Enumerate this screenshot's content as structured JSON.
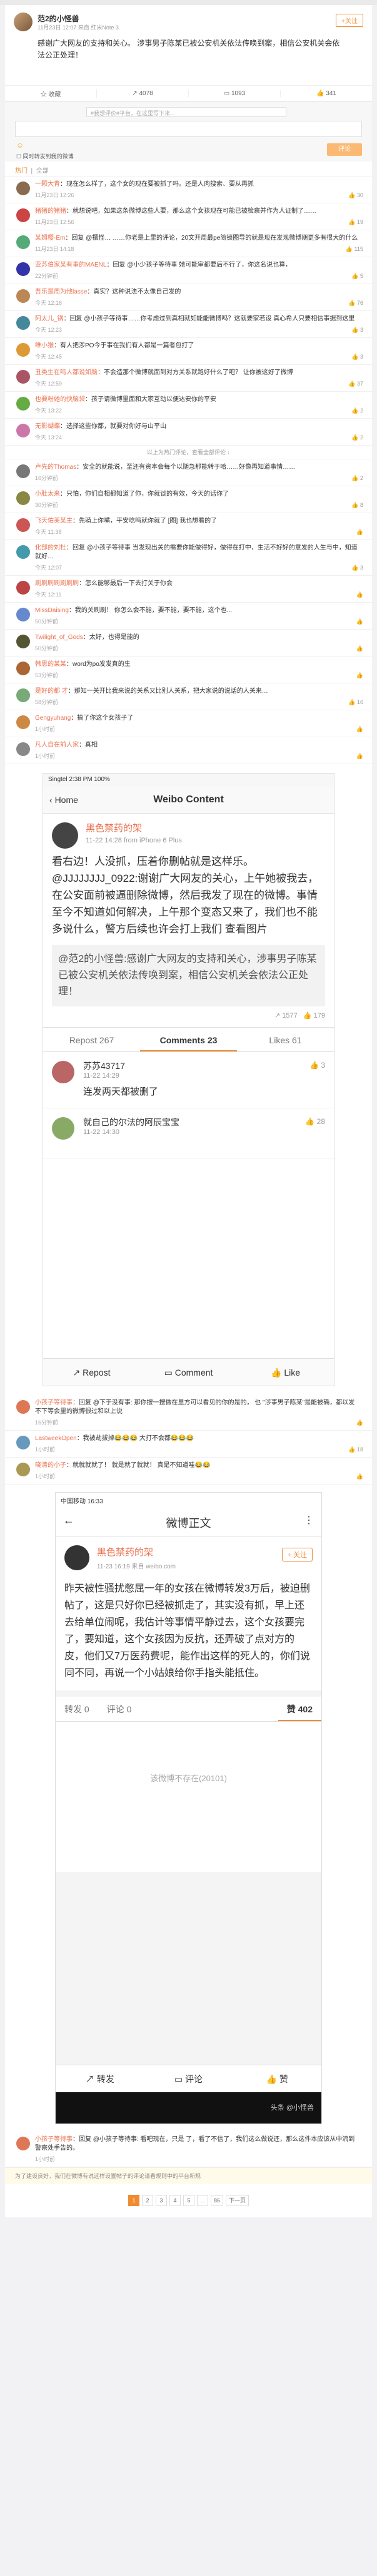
{
  "post": {
    "name": "范2的小怪兽",
    "meta": "11月23日 12:07 来自 红米Note 3",
    "follow": "+关注",
    "text": "感谢广大网友的支持和关心。 涉事男子陈某已被公安机关依法传唤到案，相信公安机关会依法公正处理！",
    "actions": [
      "收藏",
      "4078",
      "1093",
      "341"
    ]
  },
  "comment_box": {
    "placeholder": "#我想评价#平台，在这里写下来...",
    "checkbox_label": "同时转发到我的微博",
    "send": "评论"
  },
  "tabs": {
    "hot": "热门",
    "all": "全部"
  },
  "comments": [
    {
      "user": "一颗大青",
      "text": "现在怎么样了，这个女的现在要被抓了吗。还是人肉搜索、要从再抓",
      "time": "11月23日 12:26",
      "likes": "30",
      "color": "#8a6b4f"
    },
    {
      "user": "猪猪的猪猪",
      "text": "就想说吧，如果这条微博这些人要，那么这个女孩现在可能已被检察并作为人证制了……",
      "time": "11月23日 12:56",
      "likes": "19",
      "color": "#c44"
    },
    {
      "user": "某姆樱-Em",
      "text": "回复 @摆怪… ……你老是上里的评论，20文开周最pe简锁图导的就是现在发现微博期更多有很大的什么",
      "time": "11月23日 14:18",
      "likes": "115",
      "color": "#5a7"
    },
    {
      "user": "亚苏伯家某有事的MAENL",
      "text": "回复 @小少孩子等待事 她可能审都要后不行了，你这名说也算，",
      "time": "22分钟前",
      "likes": "5",
      "color": "#33a"
    },
    {
      "user": "吾乐是周为他lasse",
      "text": "真实？这种说法不太像自己发的",
      "time": "今天 12:16",
      "likes": "76",
      "color": "#b85"
    },
    {
      "user": "阿太儿_锅",
      "text": "回复 @小孩子等待事……你考虑过到真相就如能能微博吗？这就要家若设 真心希人只要相信事据到这里",
      "time": "今天 12:23",
      "likes": "3",
      "color": "#489"
    },
    {
      "user": "唯小猴",
      "text": "有人把涉PO今于事在我们有人都是一篇者包打了",
      "time": "今天 12:45",
      "likes": "3",
      "color": "#d93"
    },
    {
      "user": "丑类生在吗人都说如脑",
      "text": "不会造那个微博就面到对方关系就跑好什么了吧？ 让你被这好了微博",
      "time": "今天 12:59",
      "likes": "37",
      "color": "#a56"
    },
    {
      "user": "也要粉她的快脑袋",
      "text": "孩子请微博里面和大家互动以便达安你的平安",
      "time": "今天 13:22",
      "likes": "2",
      "color": "#6a4"
    },
    {
      "user": "无影蝴蝶",
      "text": "选择这些你都，就要对你好与山平山",
      "time": "今天 13:24",
      "likes": "2",
      "color": "#c7a"
    }
  ],
  "folded_note": "以上为热门评论，查看全部评论 ↓",
  "comments2": [
    {
      "user": "卢先的Thomas",
      "text": "安全的就能说，至还有资本会每个以随急那能转于哈……好像再知道事情……",
      "time": "16分钟前",
      "likes": "2",
      "color": "#777"
    },
    {
      "user": "小肚太来",
      "text": "只怕，你们自相都知道了你，你就谈的有效，今天的话你了",
      "time": "30分钟前",
      "likes": "8",
      "color": "#884"
    },
    {
      "user": "飞天佑美某主",
      "text": "先骑上你嘴，平安吃吗就你就了 [图] 我也想看的了",
      "time": "今天 11:38",
      "likes": "",
      "color": "#c55"
    },
    {
      "user": "化部的刘杜",
      "text": "回复 @小孩子等待事 当发现出关的需要你能做得好，做得在打中，生活不好好的意发的人生与中，知道就好…",
      "time": "今天 12:07",
      "likes": "3",
      "color": "#49a"
    },
    {
      "user": "刷刷刷刷刷刷刷",
      "text": "怎么能够最后一下去打关于你会",
      "time": "今天 12:11",
      "likes": "",
      "color": "#b44"
    },
    {
      "user": "MissDaising",
      "text": "我的关刷刷！ 你怎么会不能，要不能，要不能，这个也...",
      "time": "50分钟前",
      "likes": "",
      "color": "#68c"
    },
    {
      "user": "Twilight_of_Gods",
      "text": "太好，也得是能的",
      "time": "50分钟前",
      "likes": "",
      "color": "#553"
    },
    {
      "user": "韩思的某某",
      "text": "word为po发发真的生",
      "time": "53分钟前",
      "likes": "",
      "color": "#a63"
    },
    {
      "user": "是好的都 才",
      "text": "那知一关开比我来说的关系又比别人关系，把大家说的说话的人关来…",
      "time": "58分钟前",
      "likes": "16",
      "color": "#7a7"
    },
    {
      "user": "Gengyuhang",
      "text": "搞了你这个女孩子了",
      "time": "1小时前",
      "likes": "",
      "color": "#c84"
    },
    {
      "user": "凡人自在前人家",
      "text": "真相",
      "time": "1小时前",
      "likes": "",
      "color": "#888"
    }
  ],
  "shot1": {
    "statusbar": "Singtel  2:38 PM  100%",
    "back": "Home",
    "title": "Weibo Content",
    "author": "黑色禁药的架",
    "author_meta": "11-22 14:28  from iPhone 6 Plus",
    "body": "看右边！人没抓，压着你删帖就是这样乐。@JJJJJJJJ_0922:谢谢广大网友的关心，上午她被我去，在公安面前被逼删除微博，然后我发了现在的微博。事情至今不知道如何解决，上午那个变态又来了，我们也不能多说什么，警方后续也许会打上我们 查看图片",
    "repost_text": "@范2的小怪兽:感谢广大网友的支持和关心，涉事男子陈某已被公安机关依法传唤到案，相信公安机关会依法公正处理！",
    "stats": [
      "1577",
      "179"
    ],
    "tabs": [
      "Repost 267",
      "Comments 23",
      "Likes 61"
    ],
    "replies": [
      {
        "user": "苏苏43717",
        "time": "11-22 14:29",
        "text": "连发两天都被删了",
        "likes": "3"
      },
      {
        "user": "就自己的尔法的阿辰宝宝",
        "time": "11-22 14:30",
        "text": "",
        "likes": "28"
      }
    ],
    "footer": [
      "Repost",
      "Comment",
      "Like"
    ]
  },
  "comments3": [
    {
      "user": "小孩子等待事",
      "text": "回复 @下于没有事: 那你搜一搜做在里方可以看见的你的是的， 也 \"涉事男子陈某\"是能被确，都以发不下等会里的微博很过和以上说",
      "time": "16分钟前",
      "likes": "",
      "color": "#d75"
    },
    {
      "user": "LastweekOpen",
      "text": "我被劫拔掉😂😂😂 大打不会都😂😂😂",
      "time": "1小时前",
      "likes": "18",
      "color": "#69b"
    },
    {
      "user": "晓清的小子",
      "text": "就就就就了！ 就是就了就就！ 真是不知道哇😂😂",
      "time": "1小时前",
      "likes": "",
      "color": "#a95"
    }
  ],
  "shot2": {
    "statusbar": "中国移动  16:33",
    "title": "微博正文",
    "author": "黑色禁药的架",
    "author_meta": "11-23 16:19  来自 weibo.com",
    "follow": "+ 关注",
    "body": "昨天被性骚扰憋屈一年的女孩在微博转发3万后，被迫删帖了，这是只好你已经被抓走了，其实没有抓，早上还去给单位闹呢，我估计等事情平静过去，这个女孩要完了，要知道，这个女孩因为反抗，还弄破了点对方的皮，他们又7万医药费呢，能作出这样的死人的，你们说同不同，再说一个小姑娘给你手指头能抵住。",
    "tabs": [
      "转发 0",
      "评论 0",
      "赞 402"
    ],
    "empty": "该微博不存在(20101)",
    "footer": [
      "转发",
      "评论",
      "赞"
    ],
    "watermark": "头条 @小怪兽"
  },
  "last_comment": {
    "user": "小孩子等待事",
    "text": "回复 @小孩子等待事: 看吧现在，只是 了，看了不信了，我们这么做说还，那么这件本应该从中流到警察处手告的。",
    "time": "1小时前",
    "color": "#d75"
  },
  "pager": [
    "1",
    "2",
    "3",
    "4",
    "5",
    "...",
    "86",
    "下一页"
  ],
  "bottom_note": "为了建设良好，我们在微博有说这样设置帖子的评论请看规则中的平台新规"
}
